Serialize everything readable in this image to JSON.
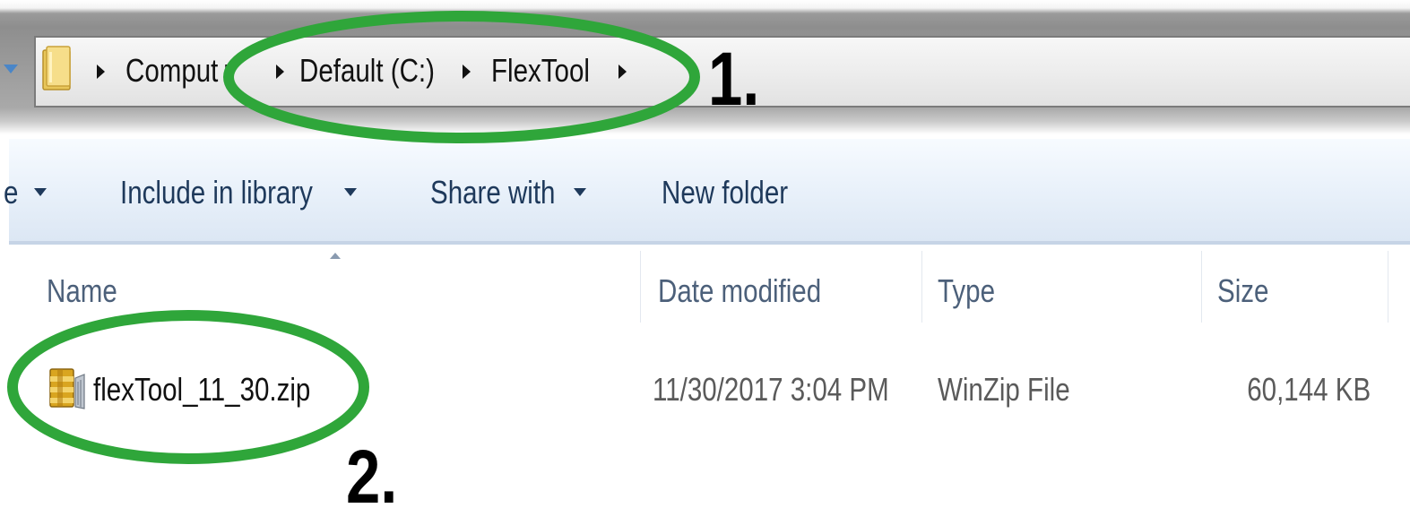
{
  "address_bar": {
    "crumbs": [
      "Computer",
      "Default (C:)",
      "FlexTool"
    ],
    "crumb_visible_text": [
      "Comput r",
      "Default (C:)",
      "FlexTool"
    ]
  },
  "toolbar": {
    "items": [
      "e",
      "Include in library",
      "Share with",
      "New folder"
    ]
  },
  "columns": {
    "name": "Name",
    "date_modified": "Date modified",
    "type": "Type",
    "size": "Size"
  },
  "files": [
    {
      "name": "flexTool_11_30.zip",
      "date_modified": "11/30/2017 3:04 PM",
      "type": "WinZip File",
      "size": "60,144 KB",
      "icon": "winzip-archive-icon"
    }
  ],
  "annotations": {
    "step1": "1.",
    "step2": "2.",
    "highlight_color": "#2fa63a"
  },
  "colors": {
    "toolbar_text": "#1e395b",
    "header_text": "#4c607a",
    "folder_yellow": "#e8c65a"
  }
}
